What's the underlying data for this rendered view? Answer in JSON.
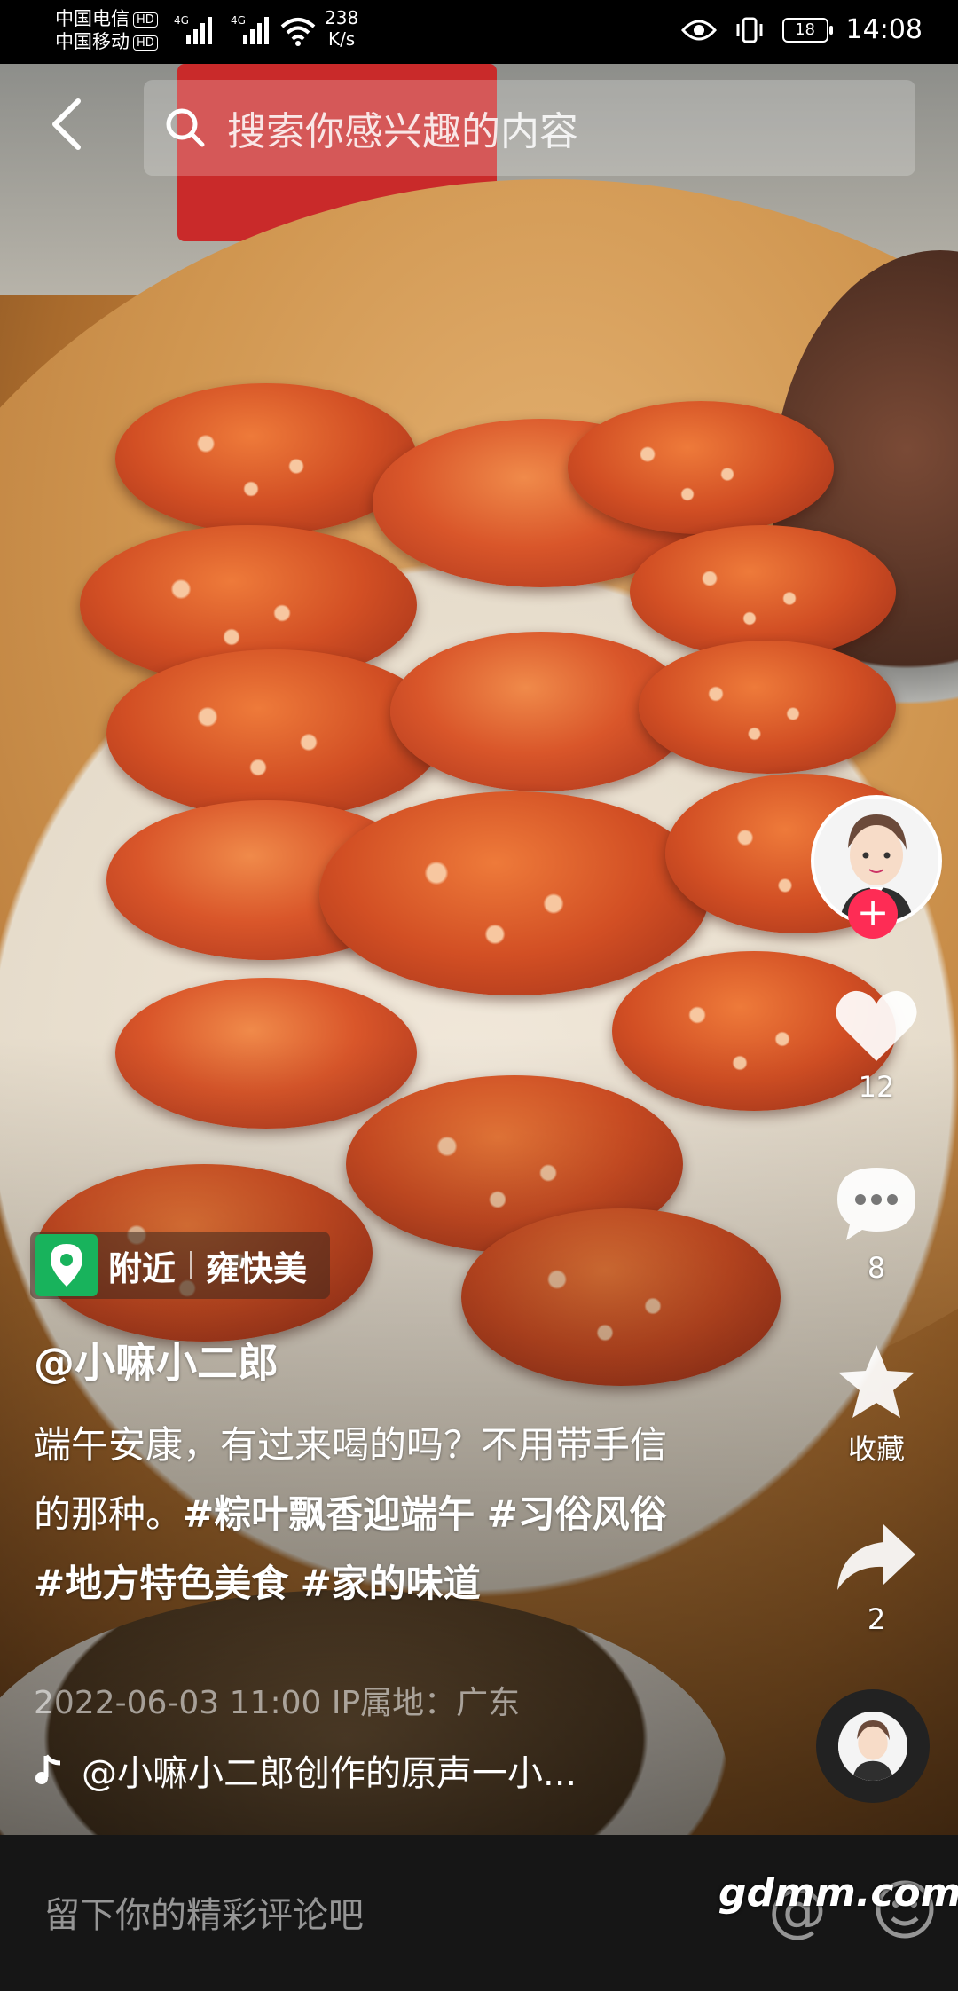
{
  "status_bar": {
    "carrier1": "中国电信",
    "carrier2": "中国移动",
    "hd": "HD",
    "net_type": "4G",
    "net_speed_value": "238",
    "net_speed_unit": "K/s",
    "battery": "18",
    "time": "14:08"
  },
  "search": {
    "placeholder": "搜索你感兴趣的内容"
  },
  "rail": {
    "like_count": "12",
    "comment_count": "8",
    "favorite_label": "收藏",
    "share_count": "2"
  },
  "post": {
    "location_tag": "附近",
    "location_name": "雍快美",
    "author": "@小嘛小二郎",
    "desc_text": "端午安康，有过来喝的吗？不用带手信的那种。",
    "tags": [
      "#粽叶飘香迎端午",
      "#习俗风俗",
      "#地方特色美食",
      "#家的味道"
    ],
    "date": "2022-06-03 11:00",
    "ip_location": "IP属地：广东",
    "music": "@小嘛小二郎创作的原声一小..."
  },
  "comment_bar": {
    "placeholder": "留下你的精彩评论吧",
    "at_symbol": "@"
  },
  "watermark": "gdmm.com",
  "colors": {
    "follow": "#fe2c55",
    "location_pin": "#18b35c"
  }
}
